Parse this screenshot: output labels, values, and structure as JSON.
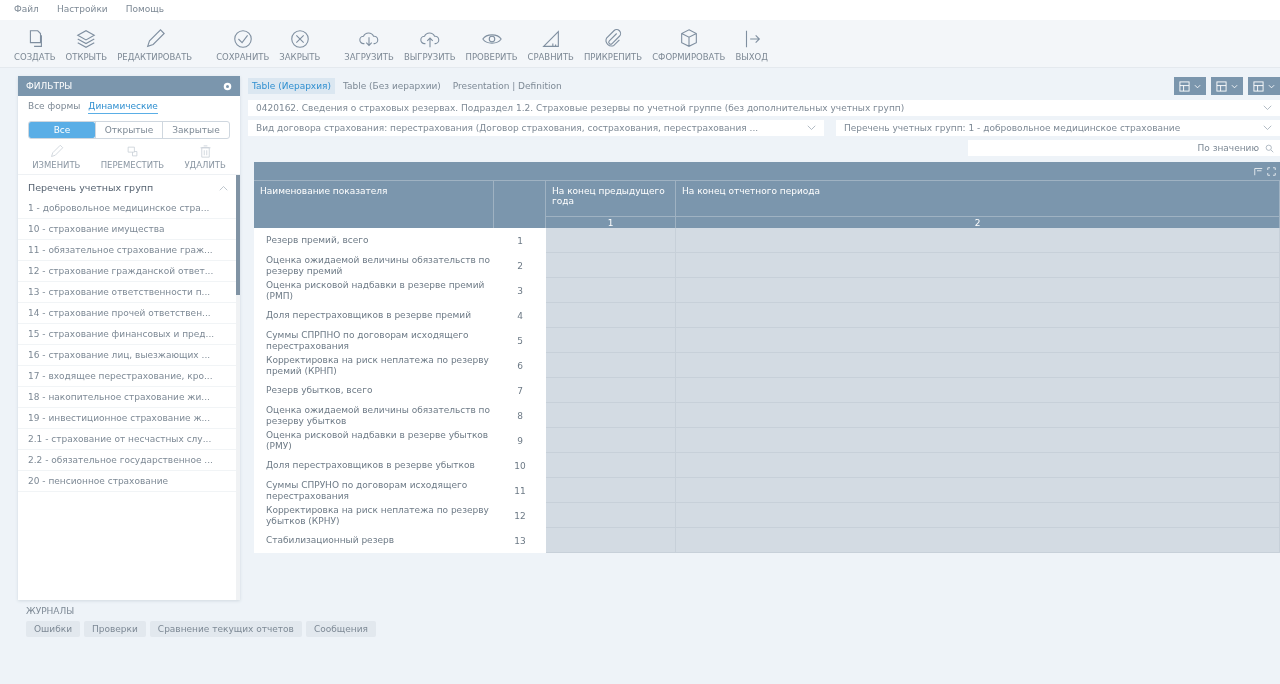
{
  "menu": [
    "Файл",
    "Настройки",
    "Помощь"
  ],
  "toolbar": [
    "СОЗДАТЬ",
    "ОТКРЫТЬ",
    "РЕДАКТИРОВАТЬ",
    "СОХРАНИТЬ",
    "ЗАКРЫТЬ",
    "ЗАГРУЗИТЬ",
    "ВЫГРУЗИТЬ",
    "ПРОВЕРИТЬ",
    "СРАВНИТЬ",
    "ПРИКРЕПИТЬ",
    "СФОРМИРОВАТЬ",
    "ВЫХОД"
  ],
  "filters": {
    "title": "ФИЛЬТРЫ",
    "tabs": [
      {
        "label": "Все формы",
        "selected": false
      },
      {
        "label": "Динамические",
        "selected": true
      }
    ],
    "segments": [
      {
        "label": "Все",
        "selected": true
      },
      {
        "label": "Открытые",
        "selected": false
      },
      {
        "label": "Закрытые",
        "selected": false
      }
    ],
    "actions": [
      "ИЗМЕНИТЬ",
      "ПЕРЕМЕСТИТЬ",
      "УДАЛИТЬ"
    ],
    "group_title": "Перечень учетных групп",
    "items": [
      "1 - добровольное медицинское стра...",
      "10 - страхование имущества",
      "11 - обязательное страхование граж...",
      "12 - страхование гражданской ответ...",
      "13 - страхование ответственности п...",
      "14 - страхование прочей ответствен...",
      "15 - страхование финансовых и пред...",
      "16 - страхование лиц, выезжающих ...",
      "17 - входящее перестрахование, кро...",
      "18 - накопительное страхование жи...",
      "19 - инвестиционное страхование ж...",
      "2.1 - страхование от несчастных слу...",
      "2.2 - обязательное государственное ...",
      "20 - пенсионное страхование"
    ]
  },
  "view_tabs": [
    {
      "label": "Table (Иерархия)",
      "selected": true
    },
    {
      "label": "Table (Без иерархии)",
      "selected": false
    },
    {
      "label": "Presentation | Definition",
      "selected": false
    }
  ],
  "form_title": "0420162. Сведения о страховых резервах. Подраздел 1.2. Страховые резервы по учетной группе (без дополнительных учетных групп)",
  "dropdowns": [
    "Вид договора страхования: перестрахования (Договор страхования, сострахования, перестрахования ...",
    "Перечень учетных групп: 1 - добровольное медицинское страхование"
  ],
  "search": {
    "placeholder": "По значению"
  },
  "table": {
    "columns": [
      {
        "label": "Наименование показателя"
      },
      {},
      {
        "label": "На конец предыдущего года",
        "number": "1"
      },
      {
        "label": "На конец отчетного периода",
        "number": "2"
      }
    ],
    "rows": [
      {
        "name": "Резерв премий, всего",
        "code": "1"
      },
      {
        "name": "Оценка ожидаемой величины обязательств по резерву премий",
        "code": "2"
      },
      {
        "name": "Оценка рисковой надбавки в резерве премий (РМП)",
        "code": "3"
      },
      {
        "name": "Доля перестраховщиков в резерве премий",
        "code": "4"
      },
      {
        "name": "Суммы СПРПНО по договорам исходящего перестрахования",
        "code": "5"
      },
      {
        "name": "Корректировка на риск неплатежа по резерву премий (КРНП)",
        "code": "6"
      },
      {
        "name": "Резерв убытков, всего",
        "code": "7"
      },
      {
        "name": "Оценка ожидаемой величины обязательств по резерву убытков",
        "code": "8"
      },
      {
        "name": "Оценка рисковой надбавки в резерве убытков (РМУ)",
        "code": "9"
      },
      {
        "name": "Доля перестраховщиков в резерве убытков",
        "code": "10"
      },
      {
        "name": "Суммы СПРУНО по договорам исходящего перестрахования",
        "code": "11"
      },
      {
        "name": "Корректировка на риск неплатежа по резерву убытков (КРНУ)",
        "code": "12"
      },
      {
        "name": "Стабилизационный резерв",
        "code": "13"
      }
    ]
  },
  "journal": {
    "title": "ЖУРНАЛЫ",
    "tabs": [
      "Ошибки",
      "Проверки",
      "Сравнение текущих отчетов",
      "Сообщения"
    ]
  }
}
